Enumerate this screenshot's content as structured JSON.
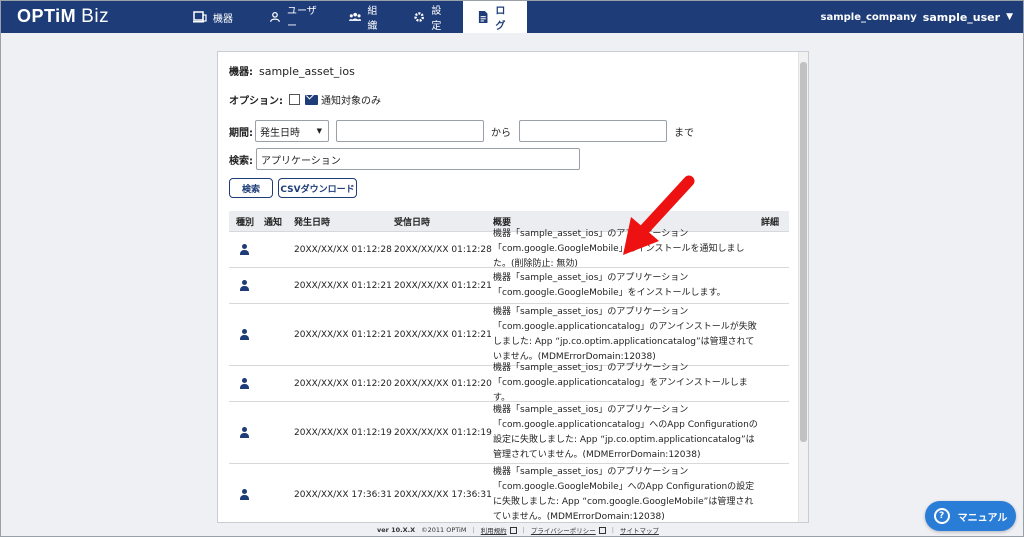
{
  "brand": {
    "name": "OPTiM",
    "product": "Biz"
  },
  "nav": [
    {
      "label": "機器",
      "icon": "device-icon"
    },
    {
      "label": "ユーザー",
      "icon": "user-icon"
    },
    {
      "label": "組織",
      "icon": "organization-icon"
    },
    {
      "label": "設定",
      "icon": "gear-icon"
    },
    {
      "label": "ログ",
      "icon": "log-icon",
      "active": true
    }
  ],
  "account": {
    "company": "sample_company",
    "user": "sample_user"
  },
  "device": {
    "label": "機器:",
    "value": "sample_asset_ios"
  },
  "option": {
    "label": "オプション:",
    "checkbox_label": "通知対象のみ",
    "checked": false
  },
  "period": {
    "label": "期間:",
    "select_value": "発生日時",
    "from_value": "",
    "sep_from": "から",
    "to_value": "",
    "sep_to": "まで"
  },
  "search": {
    "label": "検索:",
    "value": "アプリケーション"
  },
  "buttons": {
    "search": "検索",
    "csv": "CSVダウンロード"
  },
  "table": {
    "headers": {
      "type": "種別",
      "notify": "通知",
      "occurred": "発生日時",
      "received": "受信日時",
      "summary": "概要",
      "detail": "詳細"
    },
    "rows": [
      {
        "occurred": "20XX/XX/XX 01:12:28",
        "received": "20XX/XX/XX 01:12:28",
        "summary": "機器「sample_asset_ios」のアプリケーション「com.google.GoogleMobile」のインストールを通知しました。(削除防止: 無効)"
      },
      {
        "occurred": "20XX/XX/XX 01:12:21",
        "received": "20XX/XX/XX 01:12:21",
        "summary": "機器「sample_asset_ios」のアプリケーション「com.google.GoogleMobile」をインストールします。"
      },
      {
        "occurred": "20XX/XX/XX 01:12:21",
        "received": "20XX/XX/XX 01:12:21",
        "summary": "機器「sample_asset_ios」のアプリケーション「com.google.applicationcatalog」のアンインストールが失敗しました: App “jp.co.optim.applicationcatalog”は管理されていません。(MDMErrorDomain:12038)"
      },
      {
        "occurred": "20XX/XX/XX 01:12:20",
        "received": "20XX/XX/XX 01:12:20",
        "summary": "機器「sample_asset_ios」のアプリケーション「com.google.applicationcatalog」をアンインストールします。"
      },
      {
        "occurred": "20XX/XX/XX 01:12:19",
        "received": "20XX/XX/XX 01:12:19",
        "summary": "機器「sample_asset_ios」のアプリケーション「com.google.applicationcatalog」へのApp Configurationの設定に失敗しました: App “jp.co.optim.applicationcatalog”は管理されていません。(MDMErrorDomain:12038)"
      },
      {
        "occurred": "20XX/XX/XX 17:36:31",
        "received": "20XX/XX/XX 17:36:31",
        "summary": "機器「sample_asset_ios」のアプリケーション「com.google.GoogleMobile」へのApp Configurationの設定に失敗しました: App “com.google.GoogleMobile”は管理されていません。(MDMErrorDomain:12038)"
      }
    ]
  },
  "footer": {
    "version": "ver 10.X.X",
    "copyright": "©2011 OPTiM",
    "terms": "利用規約",
    "privacy": "プライバシーポリシー",
    "sitemap": "サイトマップ"
  },
  "manual": {
    "label": "マニュアル"
  },
  "colors": {
    "navy": "#1e3c78",
    "accent": "#2a7dd6",
    "arrow": "#ee1111"
  }
}
